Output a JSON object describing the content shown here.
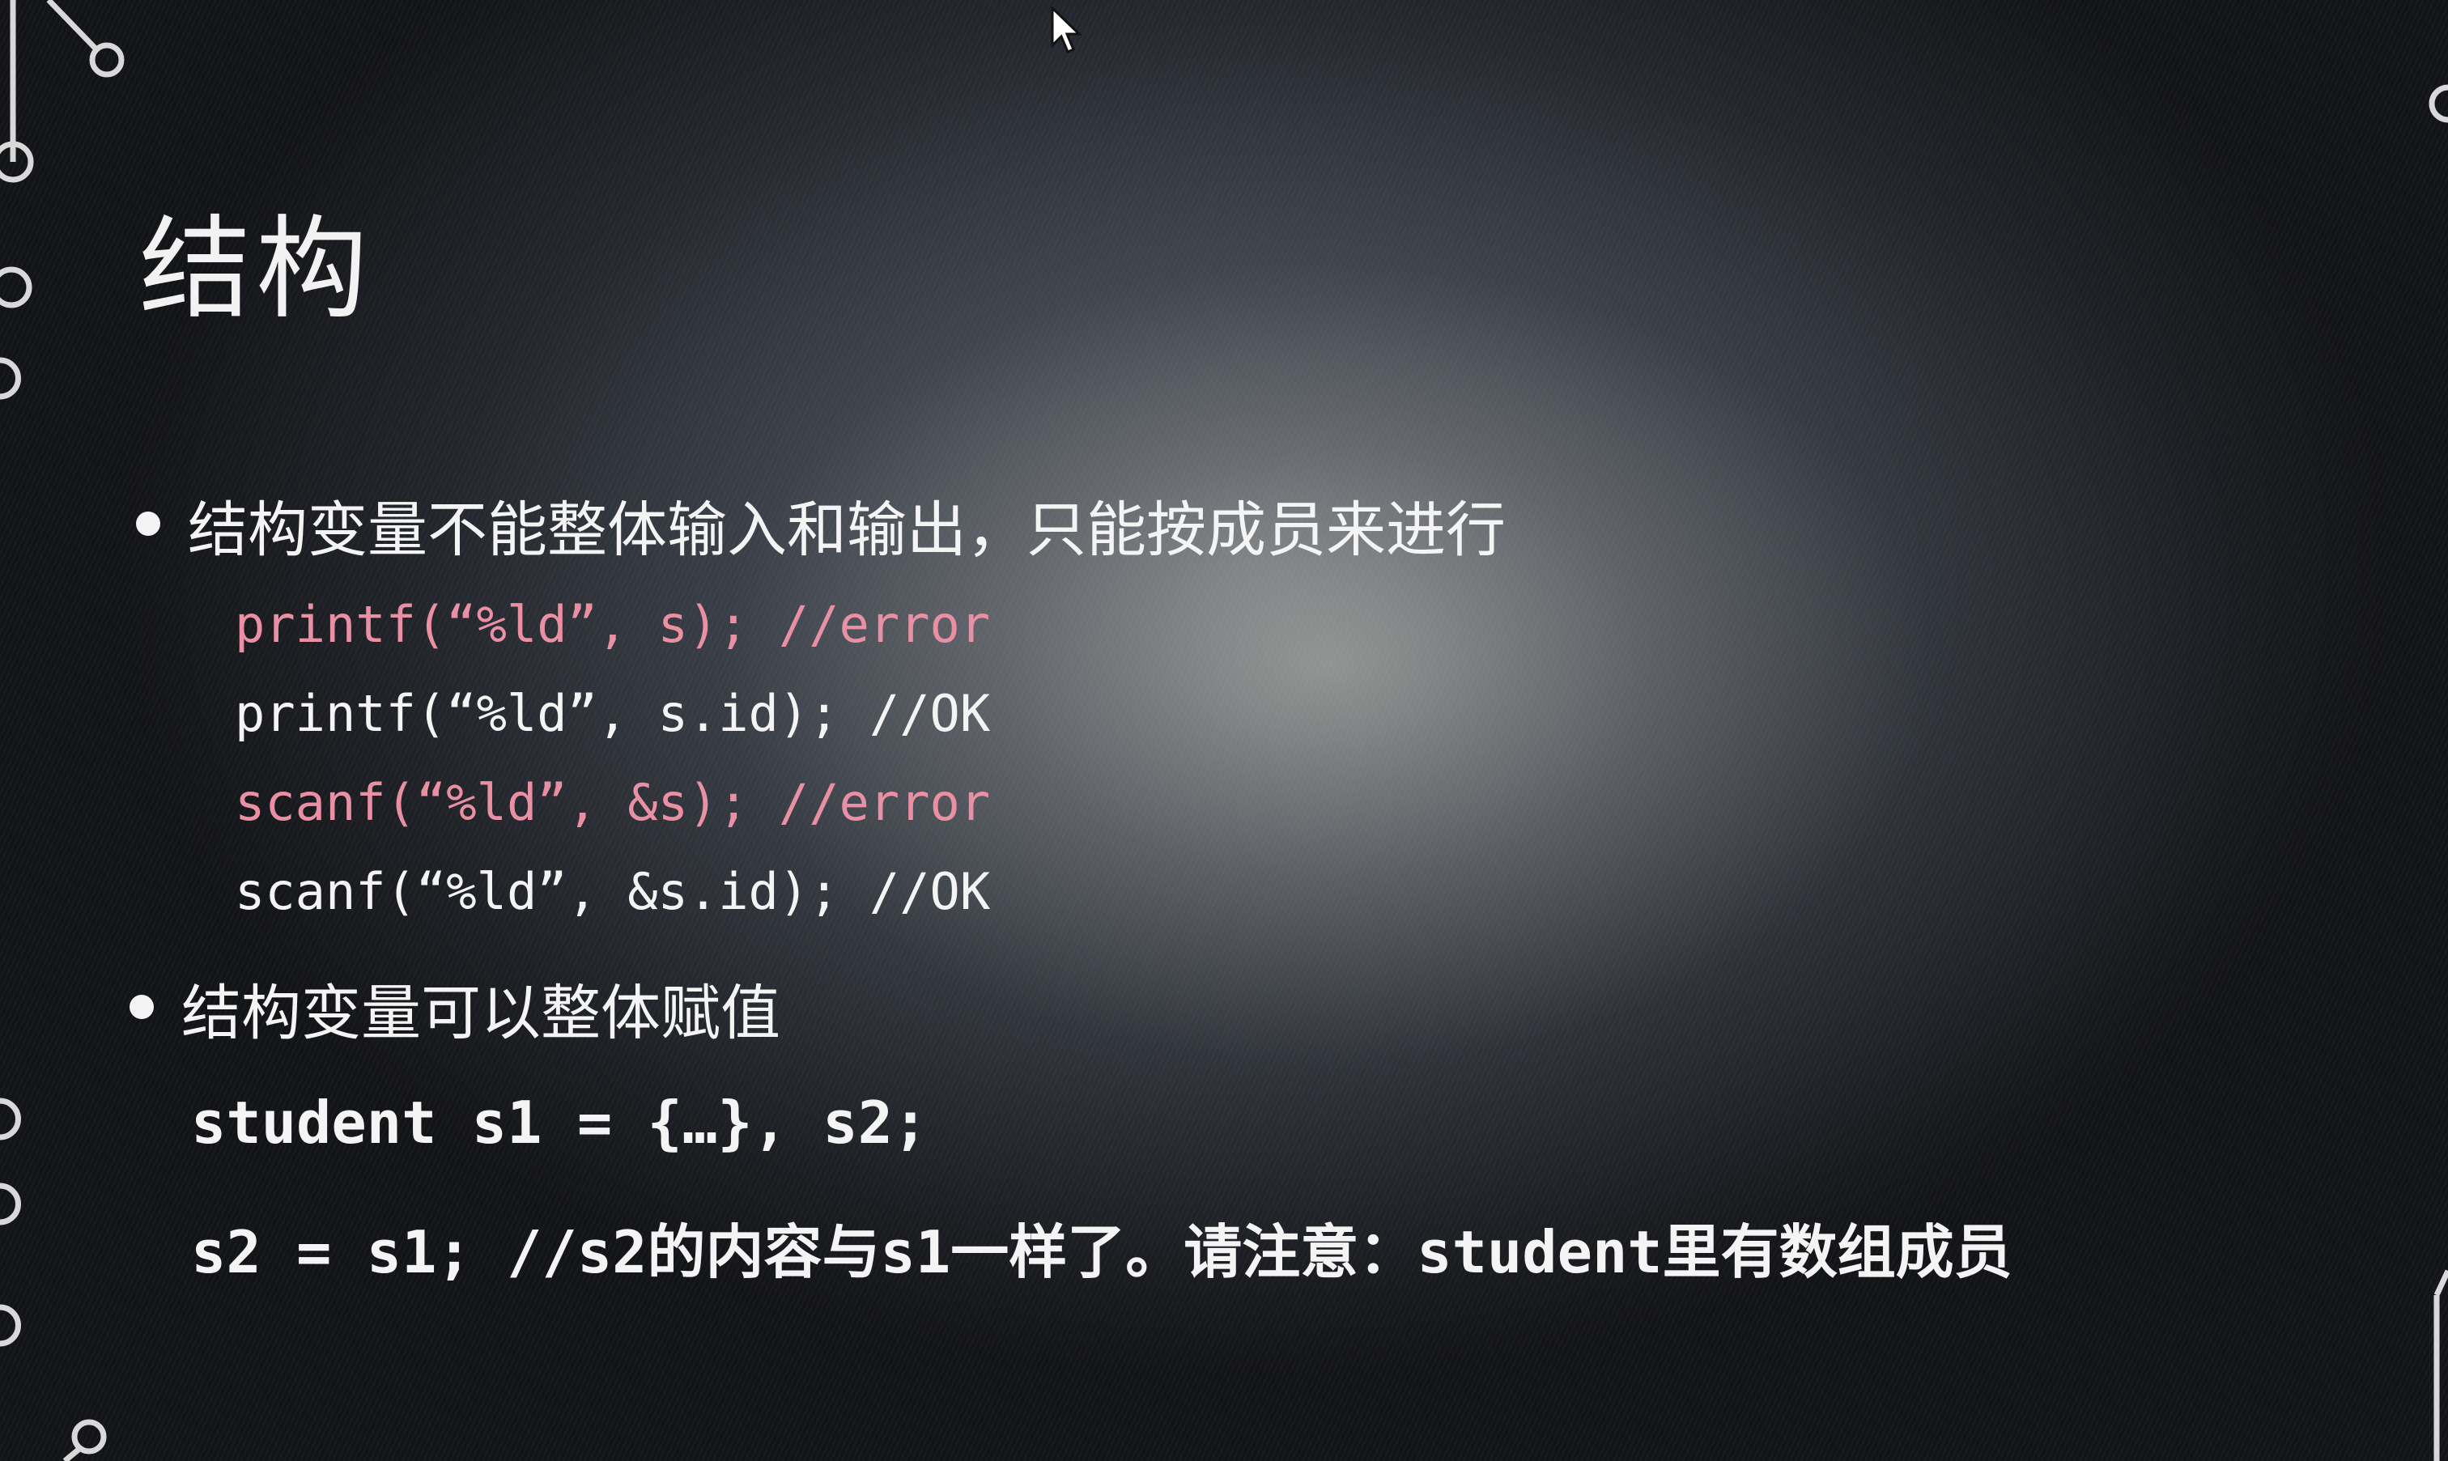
{
  "slide": {
    "title": "结构",
    "bullets": [
      {
        "text": "结构变量不能整体输入和输出，只能按成员来进行",
        "code_lines": [
          {
            "text": "printf(“%ld”, s); //error",
            "status": "error"
          },
          {
            "text": "printf(“%ld”, s.id); //OK",
            "status": "ok"
          },
          {
            "text": "scanf(“%ld”, &s); //error",
            "status": "error"
          },
          {
            "text": "scanf(“%ld”, &s.id); //OK",
            "status": "ok"
          }
        ]
      },
      {
        "text": "结构变量可以整体赋值",
        "code_lines": [
          {
            "text": "student s1 = {…}, s2;",
            "status": "ok"
          },
          {
            "text": "s2 = s1; //s2的内容与s1一样了。请注意：student里有数组成员",
            "status": "ok"
          }
        ]
      }
    ]
  },
  "colors": {
    "text": "#f4f4f4",
    "error_code": "#e98fa3",
    "background_dark": "#141518"
  },
  "icons": [
    "mouse-pointer-icon"
  ]
}
